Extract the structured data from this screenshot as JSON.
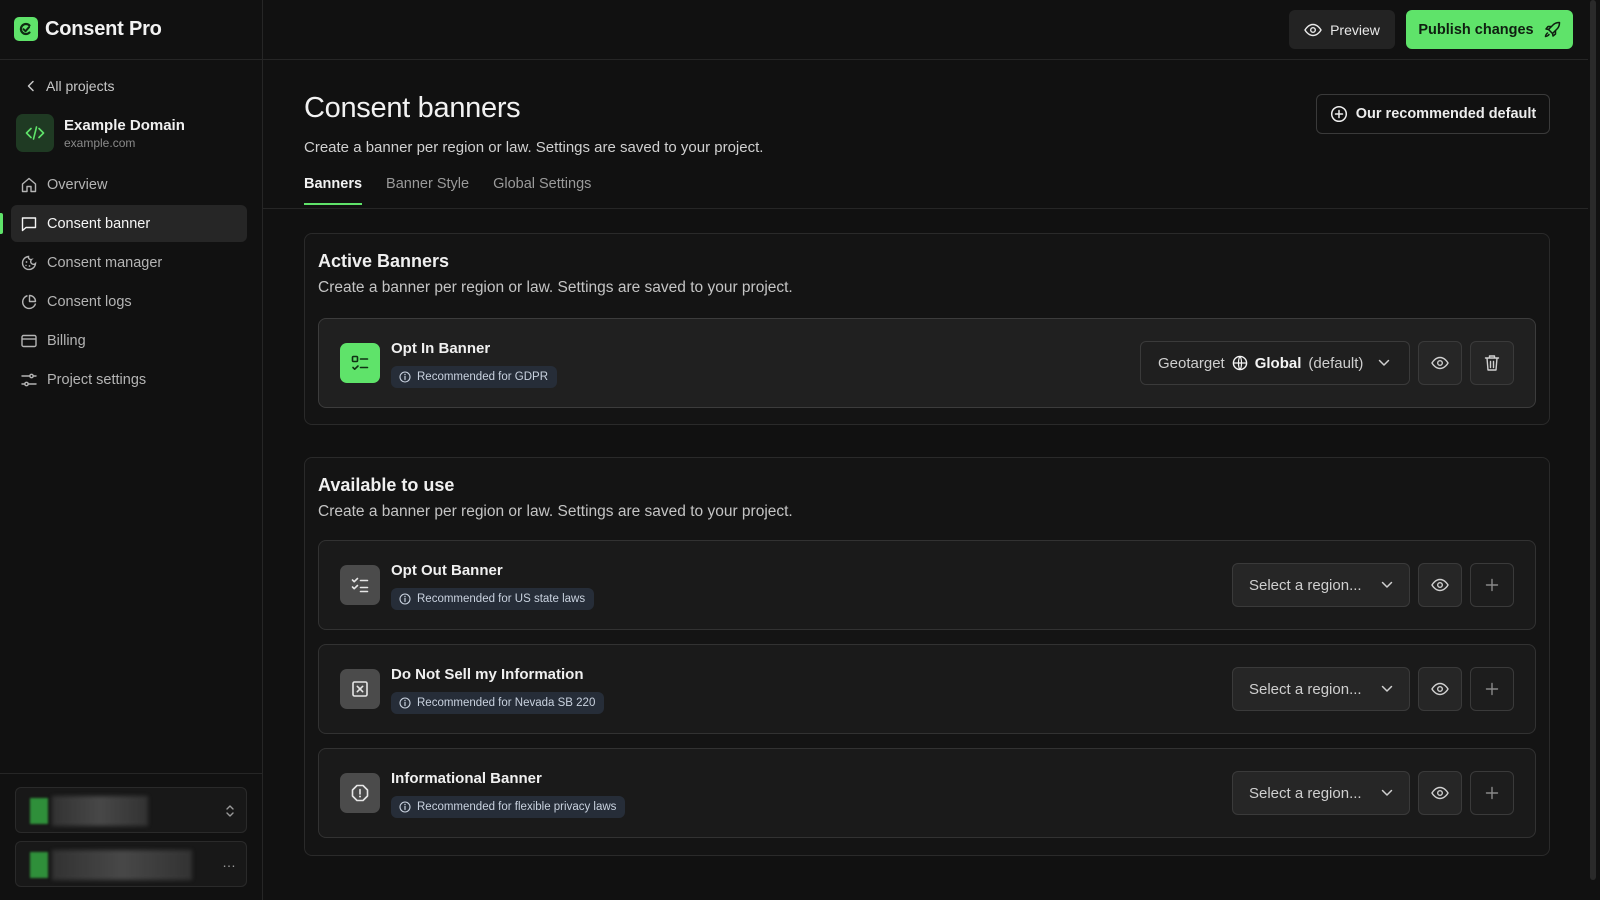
{
  "app": {
    "name": "Consent Pro"
  },
  "sidebar": {
    "back_label": "All projects",
    "project": {
      "name": "Example Domain",
      "domain": "example.com"
    },
    "items": [
      {
        "label": "Overview",
        "icon": "home-icon"
      },
      {
        "label": "Consent banner",
        "icon": "message-square-icon",
        "active": true
      },
      {
        "label": "Consent manager",
        "icon": "cookie-icon"
      },
      {
        "label": "Consent logs",
        "icon": "pie-chart-icon"
      },
      {
        "label": "Billing",
        "icon": "credit-card-icon"
      },
      {
        "label": "Project settings",
        "icon": "sliders-icon"
      }
    ],
    "account_menu_label": "…"
  },
  "topbar": {
    "preview_label": "Preview",
    "publish_label": "Publish changes"
  },
  "main": {
    "title": "Consent banners",
    "subtitle": "Create a banner per region or law. Settings are saved to your project.",
    "recommended_label": "Our recommended default",
    "tabs": [
      {
        "label": "Banners",
        "active": true
      },
      {
        "label": "Banner Style"
      },
      {
        "label": "Global Settings"
      }
    ]
  },
  "active_section": {
    "title": "Active Banners",
    "subtitle": "Create a banner per region or law. Settings are saved to your project.",
    "banners": [
      {
        "name": "Opt In Banner",
        "badge": "Recommended for GDPR",
        "geotarget_label": "Geotarget",
        "geotarget_value": "Global",
        "geotarget_suffix": "(default)"
      }
    ]
  },
  "available_section": {
    "title": "Available to use",
    "subtitle": "Create a banner per region or law. Settings are saved to your project.",
    "banners": [
      {
        "name": "Opt Out Banner",
        "badge": "Recommended for US state laws",
        "region_placeholder": "Select a region...",
        "icon": "list-check-icon"
      },
      {
        "name": "Do Not Sell my Information",
        "badge": "Recommended for Nevada SB 220",
        "region_placeholder": "Select a region...",
        "icon": "x-square-icon"
      },
      {
        "name": "Informational Banner",
        "badge": "Recommended for flexible privacy laws",
        "region_placeholder": "Select a region...",
        "icon": "alert-octagon-icon"
      }
    ]
  },
  "colors": {
    "accent": "#5fe36a",
    "background": "#111111",
    "card": "#1a1a1a",
    "badge_bg": "#262d38"
  }
}
